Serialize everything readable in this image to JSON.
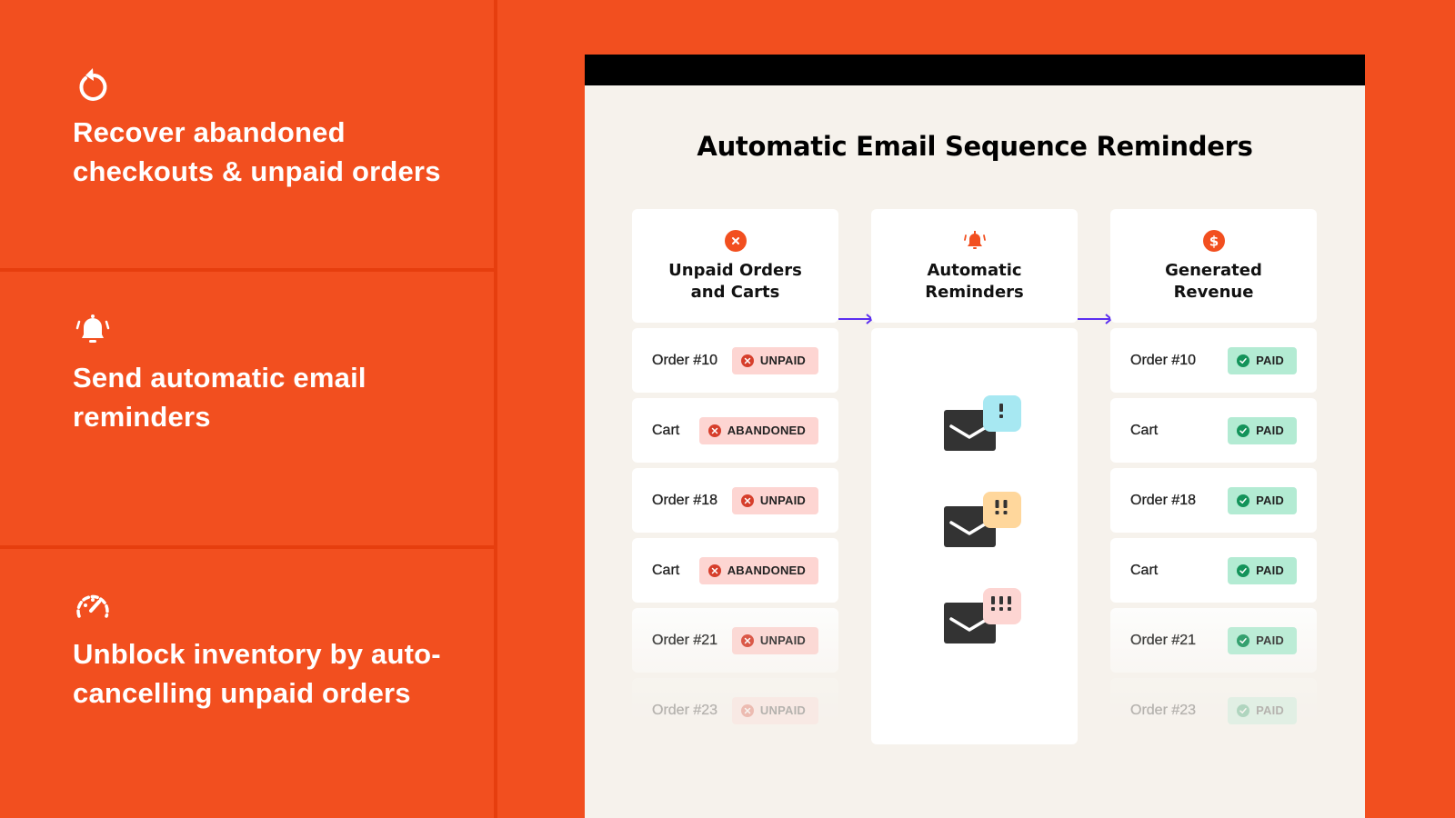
{
  "features": [
    {
      "icon": "refresh-icon",
      "text": "Recover abandoned checkouts & unpaid orders"
    },
    {
      "icon": "bell-icon",
      "text": "Send automatic email reminders"
    },
    {
      "icon": "speedometer-icon",
      "text": "Unblock inventory by auto-cancelling unpaid orders"
    }
  ],
  "card": {
    "title": "Automatic Email Sequence Reminders",
    "columns": [
      {
        "icon": "close-circle-icon",
        "title": "Unpaid Orders\nand Carts"
      },
      {
        "icon": "bell-icon",
        "title": "Automatic\nReminders"
      },
      {
        "icon": "dollar-circle-icon",
        "title": "Generated\nRevenue"
      }
    ],
    "unpaid_rows": [
      {
        "label": "Order #10",
        "status": "UNPAID"
      },
      {
        "label": "Cart",
        "status": "ABANDONED"
      },
      {
        "label": "Order #18",
        "status": "UNPAID"
      },
      {
        "label": "Cart",
        "status": "ABANDONED"
      },
      {
        "label": "Order #21",
        "status": "UNPAID"
      },
      {
        "label": "Order #23",
        "status": "UNPAID"
      }
    ],
    "reminders": [
      {
        "icon": "envelope-icon",
        "alert": "!",
        "color": "#A7E8F2"
      },
      {
        "icon": "envelope-icon",
        "alert": "!!",
        "color": "#FFD79C"
      },
      {
        "icon": "envelope-icon",
        "alert": "!!!",
        "color": "#FDD5D2"
      }
    ],
    "paid_rows": [
      {
        "label": "Order #10",
        "status": "PAID"
      },
      {
        "label": "Cart",
        "status": "PAID"
      },
      {
        "label": "Order #18",
        "status": "PAID"
      },
      {
        "label": "Cart",
        "status": "PAID"
      },
      {
        "label": "Order #21",
        "status": "PAID"
      },
      {
        "label": "Order #23",
        "status": "PAID"
      }
    ]
  },
  "colors": {
    "brand_orange": "#F24F1F",
    "arrow_purple": "#5B2EF0",
    "unpaid_badge": "#FDD5D2",
    "paid_badge": "#B3EBD3"
  }
}
